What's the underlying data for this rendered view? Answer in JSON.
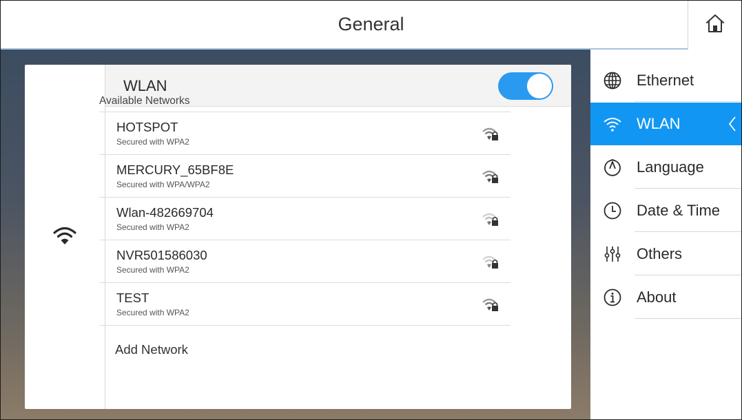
{
  "header": {
    "title": "General",
    "home_icon": "home-icon",
    "accent_color": "#a5c2de"
  },
  "main": {
    "left_icon": "wifi-icon",
    "wlan": {
      "title": "WLAN",
      "toggle_on": true,
      "toggle_color": "#2a9af0"
    },
    "available_label": "Available Networks",
    "networks": [
      {
        "name": "HOTSPOT",
        "security": "Secured with WPA2",
        "signal_icon": "wifi-lock-icon"
      },
      {
        "name": "MERCURY_65BF8E",
        "security": "Secured with WPA/WPA2",
        "signal_icon": "wifi-lock-icon"
      },
      {
        "name": "Wlan-482669704",
        "security": "Secured with WPA2",
        "signal_icon": "wifi-lock-icon"
      },
      {
        "name": "NVR501586030",
        "security": "Secured with WPA2",
        "signal_icon": "wifi-lock-icon"
      },
      {
        "name": "TEST",
        "security": "Secured with WPA2",
        "signal_icon": "wifi-lock-icon"
      }
    ],
    "add_network": "Add Network"
  },
  "sidebar": {
    "active_color": "#1296f3",
    "items": [
      {
        "label": "Ethernet",
        "icon": "globe-icon",
        "active": false
      },
      {
        "label": "WLAN",
        "icon": "wifi-icon",
        "active": true
      },
      {
        "label": "Language",
        "icon": "language-icon",
        "active": false
      },
      {
        "label": "Date & Time",
        "icon": "clock-icon",
        "active": false
      },
      {
        "label": "Others",
        "icon": "sliders-icon",
        "active": false
      },
      {
        "label": "About",
        "icon": "info-icon",
        "active": false
      }
    ]
  }
}
